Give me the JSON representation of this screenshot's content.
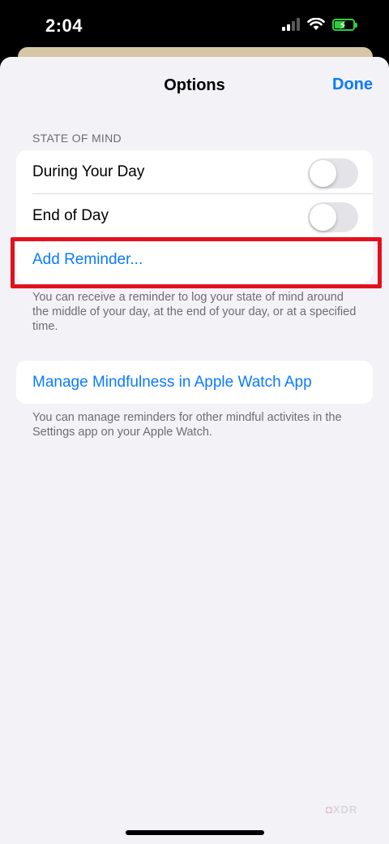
{
  "status_bar": {
    "time": "2:04",
    "icons": [
      "cellular-signal-icon",
      "wifi-icon",
      "battery-charging-icon"
    ]
  },
  "nav": {
    "title": "Options",
    "done_label": "Done"
  },
  "state_of_mind": {
    "header": "STATE OF MIND",
    "rows": [
      {
        "label": "During Your Day",
        "toggle_on": false
      },
      {
        "label": "End of Day",
        "toggle_on": false
      }
    ],
    "add_reminder_label": "Add Reminder...",
    "footer": "You can receive a reminder to log your state of mind around the middle of your day, at the end of your day, or at a specified time."
  },
  "manage": {
    "label": "Manage Mindfulness in Apple Watch App",
    "footer": "You can manage reminders for other mindful activites in the Settings app on your Apple Watch."
  },
  "watermark": "XDR",
  "colors": {
    "accent": "#0a7aff",
    "highlight": "#e3101e",
    "background": "#f2f2f7",
    "battery": "#2ecc40"
  }
}
